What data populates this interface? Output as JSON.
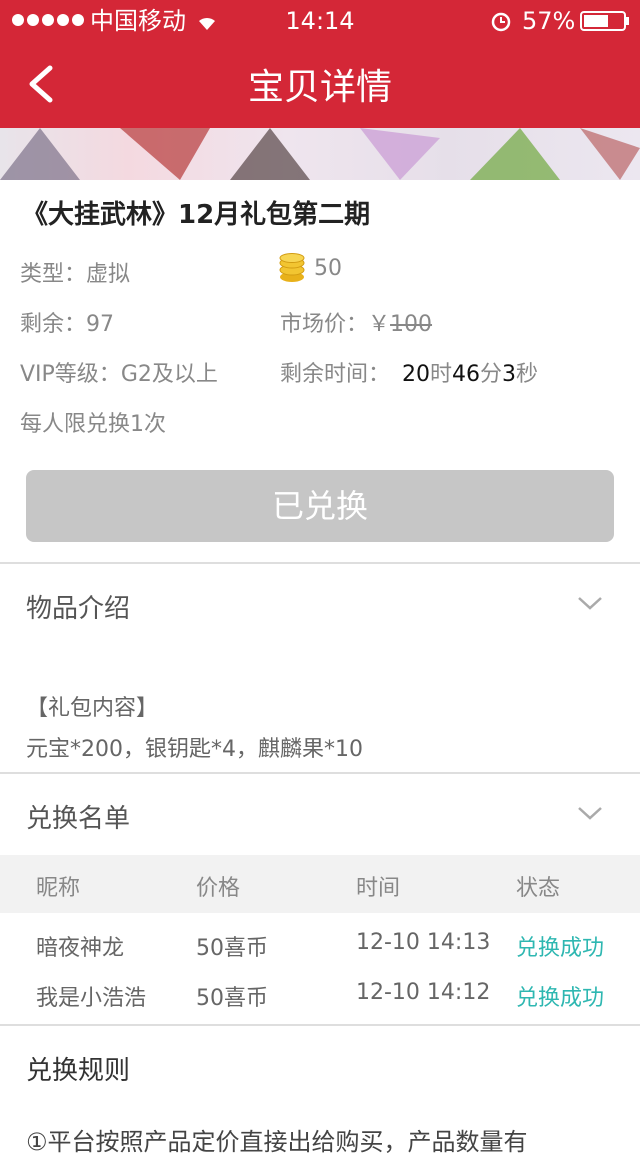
{
  "status_bar": {
    "carrier": "中国移动",
    "time": "14:14",
    "battery": "57%"
  },
  "nav": {
    "title": "宝贝详情"
  },
  "product": {
    "name": "《大挂武林》12月礼包第二期",
    "type_label": "类型：",
    "type_value": "虚拟",
    "coin_value": "50",
    "remaining_label": "剩余：",
    "remaining_value": "97",
    "market_label": "市场价：",
    "currency": "￥",
    "market_value": "100",
    "vip_label": "VIP等级：",
    "vip_value": "G2及以上",
    "time_left_label": "剩余时间：",
    "hours": "20",
    "hours_unit": "时",
    "minutes": "46",
    "minutes_unit": "分",
    "seconds": "3",
    "seconds_unit": "秒",
    "limit": "每人限兑换1次",
    "button": "已兑换"
  },
  "intro": {
    "title": "物品介绍",
    "content_title": "【礼包内容】",
    "content": "元宝*200，银钥匙*4，麒麟果*10"
  },
  "list": {
    "title": "兑换名单",
    "headers": [
      "昵称",
      "价格",
      "时间",
      "状态"
    ],
    "rows": [
      [
        "暗夜神龙",
        "50喜币",
        "12-10 14:13",
        "兑换成功"
      ],
      [
        "我是小浩浩",
        "50喜币",
        "12-10 14:12",
        "兑换成功"
      ]
    ]
  },
  "rules": {
    "title": "兑换规则",
    "first_line": "①平台按照产品定价直接出给购买，产品数量有"
  },
  "colors": {
    "header": "#d42737",
    "success": "#2eb7b1",
    "coin": "#e8b11a"
  }
}
